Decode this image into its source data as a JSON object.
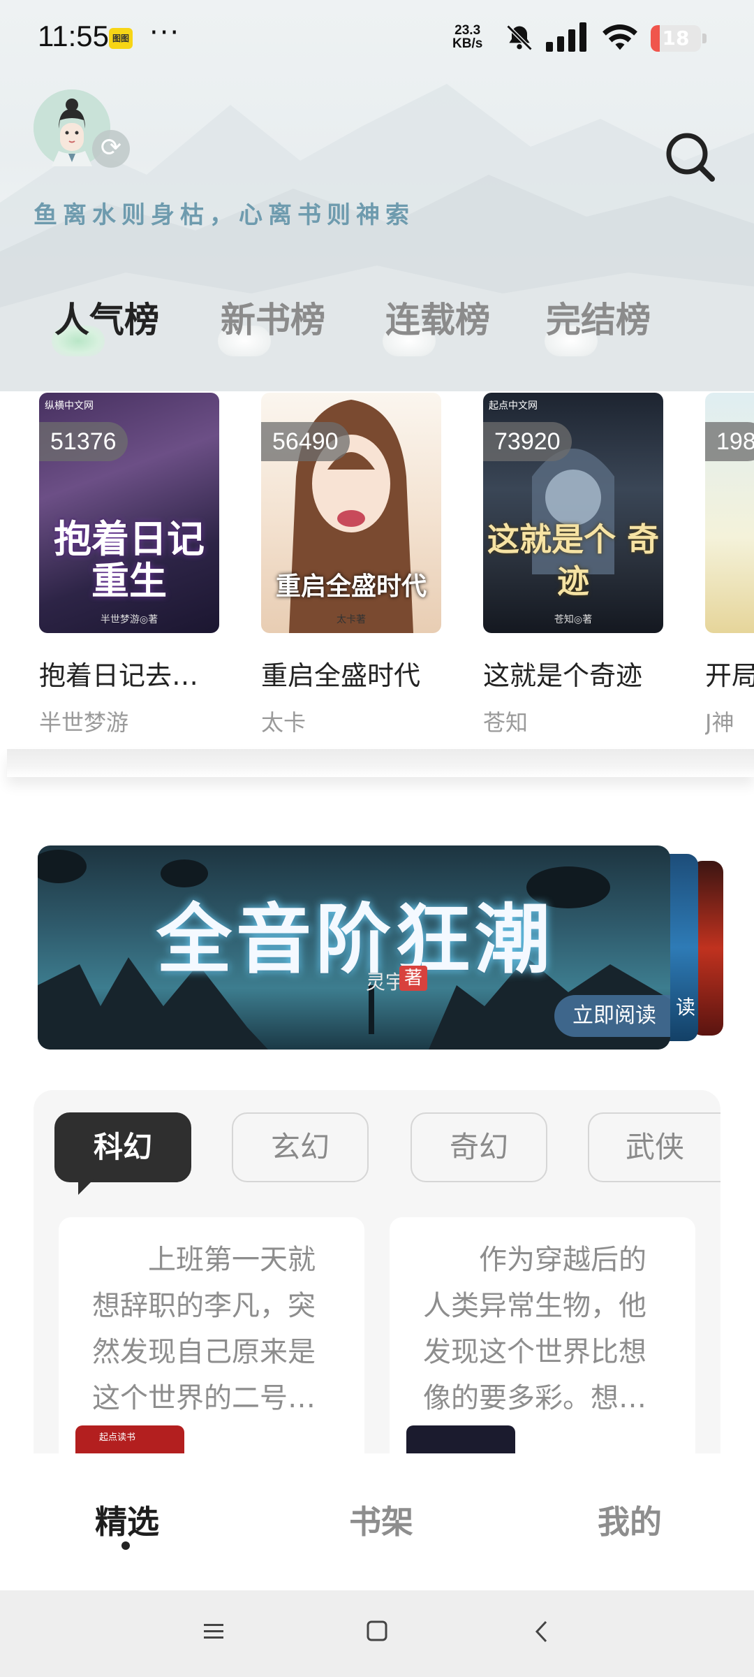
{
  "status_bar": {
    "time": "11:55",
    "app_badge": "图图",
    "more": "···",
    "net_speed_value": "23.3",
    "net_speed_unit": "KB/s",
    "battery_level": 18,
    "battery_text": "18",
    "icons": [
      "bell-off-icon",
      "signal-icon",
      "wifi-icon",
      "battery-icon"
    ]
  },
  "header": {
    "slogan": "鱼离水则身枯，心离书则神索",
    "avatar": "avatar-image",
    "search_icon": "search-icon"
  },
  "rank_tabs": [
    {
      "label": "人气榜",
      "active": true
    },
    {
      "label": "新书榜",
      "active": false
    },
    {
      "label": "连载榜",
      "active": false
    },
    {
      "label": "完结榜",
      "active": false
    }
  ],
  "books": [
    {
      "count": "51376",
      "title": "抱着日记去…",
      "author": "半世梦游",
      "cover_title": "抱着日记 重生",
      "cover_author": "半世梦游◎著",
      "publisher": "纵横中文网"
    },
    {
      "count": "56490",
      "title": "重启全盛时代",
      "author": "太卡",
      "cover_title": "重启全盛时代",
      "cover_author": "太卡著",
      "publisher": ""
    },
    {
      "count": "73920",
      "title": "这就是个奇迹",
      "author": "苍知",
      "cover_title": "这就是个 奇迹",
      "cover_author": "苍知◎著",
      "publisher": "起点中文网"
    },
    {
      "count": "198",
      "title": "开局",
      "author": "J神",
      "cover_title": "",
      "cover_author": "",
      "publisher": ""
    }
  ],
  "banner": {
    "title": "全音阶狂潮",
    "author": "灵宇",
    "author_tag": "著",
    "read_button": "立即阅读",
    "peek_read": "读"
  },
  "categories": [
    {
      "label": "科幻",
      "active": true
    },
    {
      "label": "玄幻",
      "active": false
    },
    {
      "label": "奇幻",
      "active": false
    },
    {
      "label": "武侠",
      "active": false
    }
  ],
  "recommendations": [
    {
      "desc": "上班第一天就想辞职的李凡，突然发现自己原来是这个世界的二号…",
      "publisher": "起点读书"
    },
    {
      "desc": "作为穿越后的人类异常生物，他发现这个世界比想像的要多彩。想…",
      "publisher": ""
    }
  ],
  "bottom_nav": [
    {
      "label": "精选",
      "active": true
    },
    {
      "label": "书架",
      "active": false
    },
    {
      "label": "我的",
      "active": false
    }
  ],
  "system_nav": {
    "icons": [
      "menu-icon",
      "home-icon",
      "back-icon"
    ]
  }
}
